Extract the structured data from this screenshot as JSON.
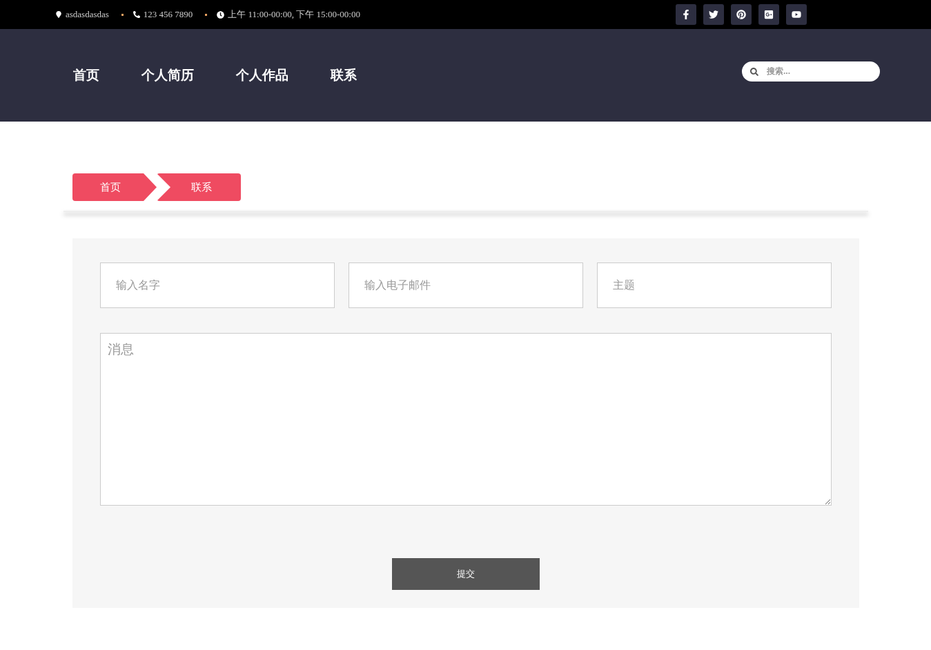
{
  "topbar": {
    "address": "asdasdasdas",
    "phone": "123 456 7890",
    "hours": "上午 11:00-00:00, 下午 15:00-00:00"
  },
  "social": [
    {
      "kind": "facebook"
    },
    {
      "kind": "twitter"
    },
    {
      "kind": "pinterest"
    },
    {
      "kind": "google-plus"
    },
    {
      "kind": "youtube"
    }
  ],
  "nav": {
    "items": [
      {
        "label": "首页"
      },
      {
        "label": "个人简历"
      },
      {
        "label": "个人作品"
      },
      {
        "label": "联系"
      }
    ],
    "search": {
      "placeholder": "搜索..."
    }
  },
  "breadcrumb": [
    {
      "label": "首页"
    },
    {
      "label": "联系"
    }
  ],
  "form": {
    "fields": [
      {
        "placeholder": "输入名字"
      },
      {
        "placeholder": "输入电子邮件"
      },
      {
        "placeholder": "主题"
      }
    ],
    "message": {
      "placeholder": "消息"
    },
    "submit": "提交"
  }
}
